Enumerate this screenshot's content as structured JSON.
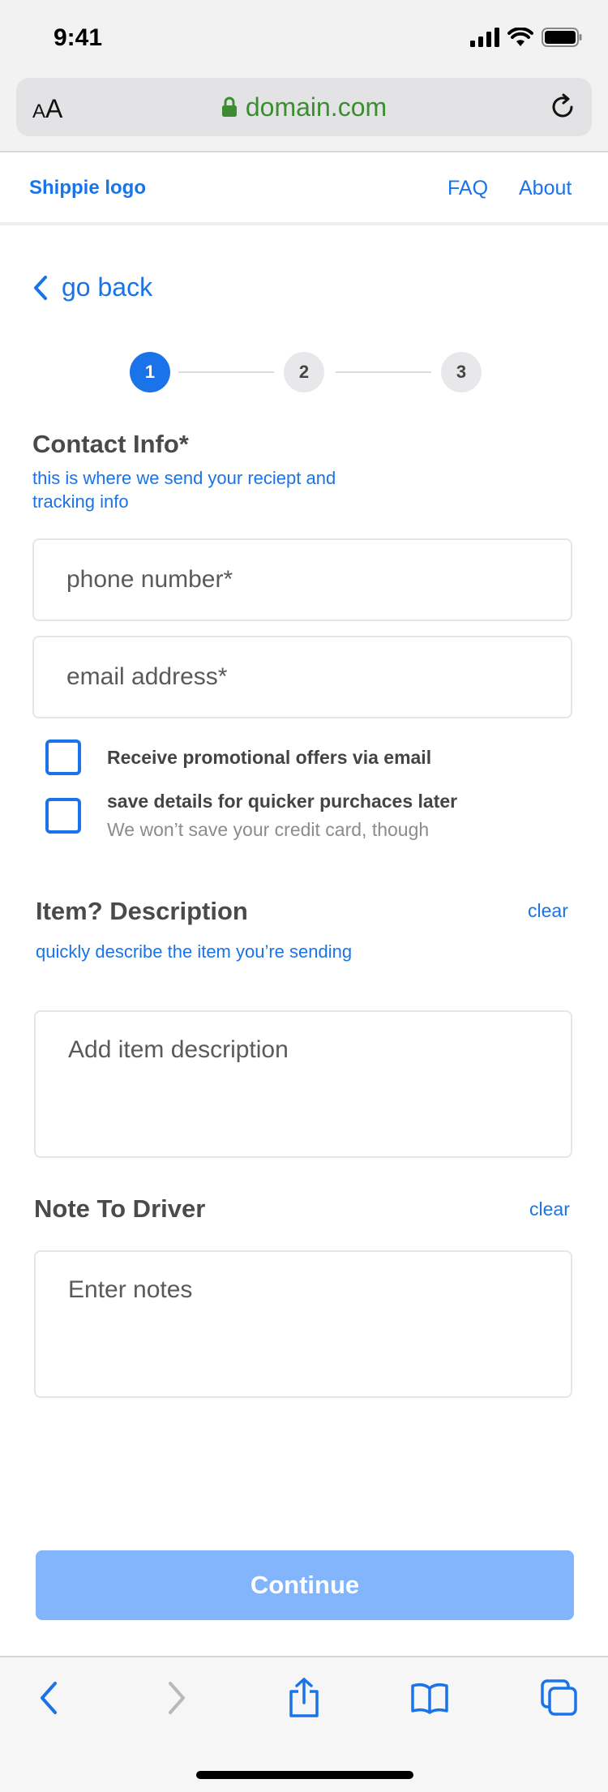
{
  "status_bar": {
    "time": "9:41"
  },
  "browser": {
    "text_size_label_small": "A",
    "text_size_label_large": "A",
    "domain": "domain.com"
  },
  "header": {
    "logo": "Shippie logo",
    "nav_faq": "FAQ",
    "nav_about": "About"
  },
  "back": {
    "label": "go back"
  },
  "stepper": {
    "steps": [
      "1",
      "2",
      "3"
    ],
    "current": 1
  },
  "contact": {
    "title": "Contact Info*",
    "subtitle": "this is where we send your reciept and tracking info",
    "phone_placeholder": "phone number*",
    "email_placeholder": "email address*",
    "promo_label": "Receive promotional offers via email",
    "save_label": "save details for quicker purchaces later",
    "save_hint": "We won’t save your credit card, though"
  },
  "item": {
    "title": "Item? Description",
    "subtitle": "quickly describe the item you’re sending",
    "clear": "clear",
    "placeholder": "Add item description"
  },
  "note": {
    "title": "Note To Driver",
    "clear": "clear",
    "placeholder": "Enter notes"
  },
  "continue_label": "Continue",
  "colors": {
    "accent": "#1a73e8",
    "button_disabled": "#82b5fb",
    "domain_green": "#3d8c34"
  },
  "toolbar_icons": [
    "back-icon",
    "forward-icon",
    "share-icon",
    "bookmarks-icon",
    "tabs-icon"
  ]
}
